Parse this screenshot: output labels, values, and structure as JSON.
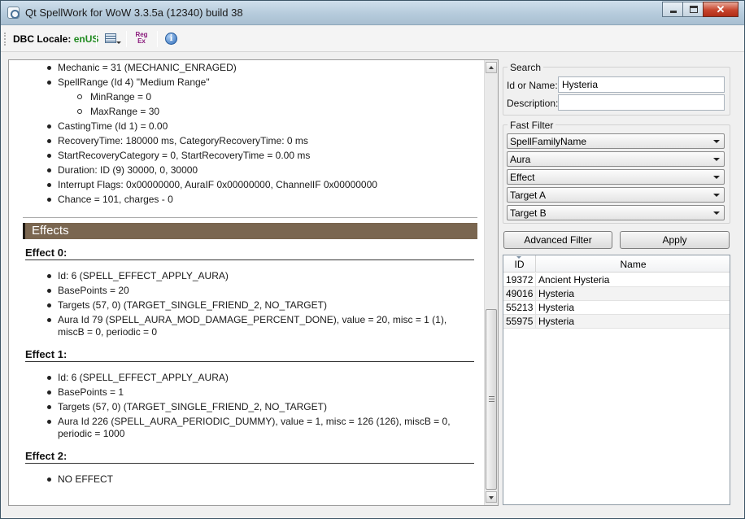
{
  "window": {
    "title": "Qt SpellWork for WoW 3.3.5a (12340) build 38",
    "close_glyph": "✕"
  },
  "toolbar": {
    "locale_label": "DBC Locale:",
    "locale_value": "enUS",
    "regex_icon_top": "Reg",
    "regex_icon_bottom": "Ex",
    "info_icon_glyph": "i"
  },
  "details": {
    "lines": [
      "Mechanic = 31 (MECHANIC_ENRAGED)",
      "SpellRange (Id 4) \"Medium Range\"",
      "MinRange = 0",
      "MaxRange = 30",
      "CastingTime (Id 1) = 0.00",
      "RecoveryTime: 180000 ms, CategoryRecoveryTime: 0 ms",
      "StartRecoveryCategory = 0, StartRecoveryTime = 0.00 ms",
      "Duration: ID (9) 30000, 0, 30000",
      "Interrupt Flags: 0x00000000, AuraIF 0x00000000, ChannelIF 0x00000000",
      "Chance = 101, charges - 0"
    ],
    "effects_header": "Effects",
    "effects": [
      {
        "title": "Effect 0:",
        "items": [
          "Id: 6 (SPELL_EFFECT_APPLY_AURA)",
          "BasePoints = 20",
          "Targets (57, 0) (TARGET_SINGLE_FRIEND_2, NO_TARGET)",
          "Aura Id 79 (SPELL_AURA_MOD_DAMAGE_PERCENT_DONE), value = 20, misc = 1 (1),",
          "miscB = 0, periodic = 0"
        ]
      },
      {
        "title": "Effect 1:",
        "items": [
          "Id: 6 (SPELL_EFFECT_APPLY_AURA)",
          "BasePoints = 1",
          "Targets (57, 0) (TARGET_SINGLE_FRIEND_2, NO_TARGET)",
          "Aura Id 226 (SPELL_AURA_PERIODIC_DUMMY), value = 1, misc = 126 (126), miscB = 0,",
          "periodic = 1000"
        ]
      },
      {
        "title": "Effect 2:",
        "items": [
          "NO EFFECT"
        ]
      }
    ]
  },
  "search": {
    "group_title": "Search",
    "id_or_name_label": "Id or Name:",
    "id_or_name_value": "Hysteria",
    "description_label": "Description:",
    "description_value": ""
  },
  "fast_filter": {
    "group_title": "Fast Filter",
    "combos": [
      "SpellFamilyName",
      "Aura",
      "Effect",
      "Target A",
      "Target B"
    ]
  },
  "buttons": {
    "advanced_filter": "Advanced Filter",
    "apply": "Apply"
  },
  "results": {
    "columns": [
      "ID",
      "Name"
    ],
    "rows": [
      {
        "id": "19372",
        "name": "Ancient Hysteria"
      },
      {
        "id": "49016",
        "name": "Hysteria"
      },
      {
        "id": "55213",
        "name": "Hysteria"
      },
      {
        "id": "55975",
        "name": "Hysteria"
      }
    ]
  }
}
